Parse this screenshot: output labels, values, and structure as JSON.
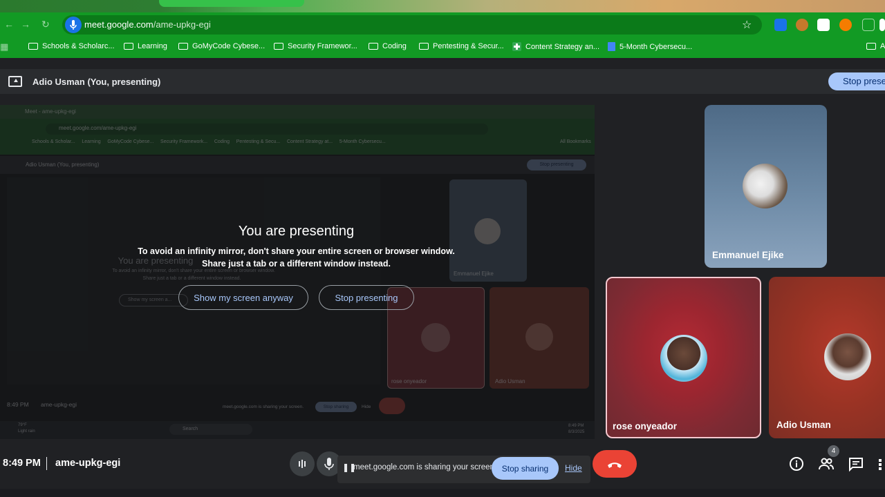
{
  "browser": {
    "url_host": "meet.google.com",
    "url_path": "/ame-upkg-egi",
    "bookmarks": [
      {
        "label": "Schools & Scholarc...",
        "kind": "folder"
      },
      {
        "label": "Learning",
        "kind": "folder"
      },
      {
        "label": "GoMyCode Cybese...",
        "kind": "folder"
      },
      {
        "label": "Security Framewor...",
        "kind": "folder"
      },
      {
        "label": "Coding",
        "kind": "folder"
      },
      {
        "label": "Pentesting & Secur...",
        "kind": "folder"
      },
      {
        "label": "Content Strategy an...",
        "kind": "sheet"
      },
      {
        "label": "5-Month Cybersecu...",
        "kind": "doc"
      },
      {
        "label": "A",
        "kind": "folder"
      }
    ]
  },
  "presenting": {
    "title": "Adio Usman (You, presenting)",
    "stop_button": "Stop prese"
  },
  "overlay": {
    "title": "You are presenting",
    "message_line1": "To avoid an infinity mirror, don't share your entire screen or browser window.",
    "message_line2": "Share just a tab or a different window instead.",
    "show_anyway": "Show my screen anyway",
    "stop_presenting": "Stop presenting"
  },
  "participants": [
    {
      "name": "Emmanuel Ejike"
    },
    {
      "name": "rose onyeador"
    },
    {
      "name": "Adio Usman"
    }
  ],
  "mirror": {
    "title": "Adio Usman (You, presenting)",
    "stop": "Stop presenting",
    "url": "meet.google.com/ame-upkg-egi",
    "overlay_title": "You are presenting",
    "tile_names": [
      "Emmanuel Ejike",
      "rose onyeador",
      "Adio Usman"
    ],
    "clock": "8:49 PM",
    "code": "ame-upkg-egi",
    "share_text": "meet.google.com is sharing your screen.",
    "stop_sharing": "Stop sharing",
    "hide": "Hide",
    "search": "Search",
    "tab_title": "Meet - ame-upkg-egi",
    "show_anyway": "Show my screen a...",
    "msg1": "To avoid an infinity mirror, don't share your entire screen or browser window.",
    "msg2": "Share just a tab or a different window instead.",
    "bookmarks": [
      "Schools & Scholar...",
      "Learning",
      "GoMyCode Cybese...",
      "Security Framework...",
      "Coding",
      "Pentesting & Secu...",
      "Content Strategy at...",
      "5-Month Cybersecu..."
    ],
    "all_bookmarks": "All Bookmarks",
    "weather": "79°F",
    "weather_desc": "Light rain",
    "tray_time": "8:49 PM",
    "tray_date": "8/3/2025"
  },
  "bottom": {
    "clock": "8:49 PM",
    "meeting_code": "ame-upkg-egi",
    "share_text": "meet.google.com is sharing your screen.",
    "stop_sharing": "Stop sharing",
    "hide": "Hide",
    "people_count": "4"
  },
  "colors": {
    "chrome_green": "#129a24",
    "meet_bg": "#202124",
    "accent_blue": "#a8c7fa",
    "leave_red": "#ea4335"
  }
}
